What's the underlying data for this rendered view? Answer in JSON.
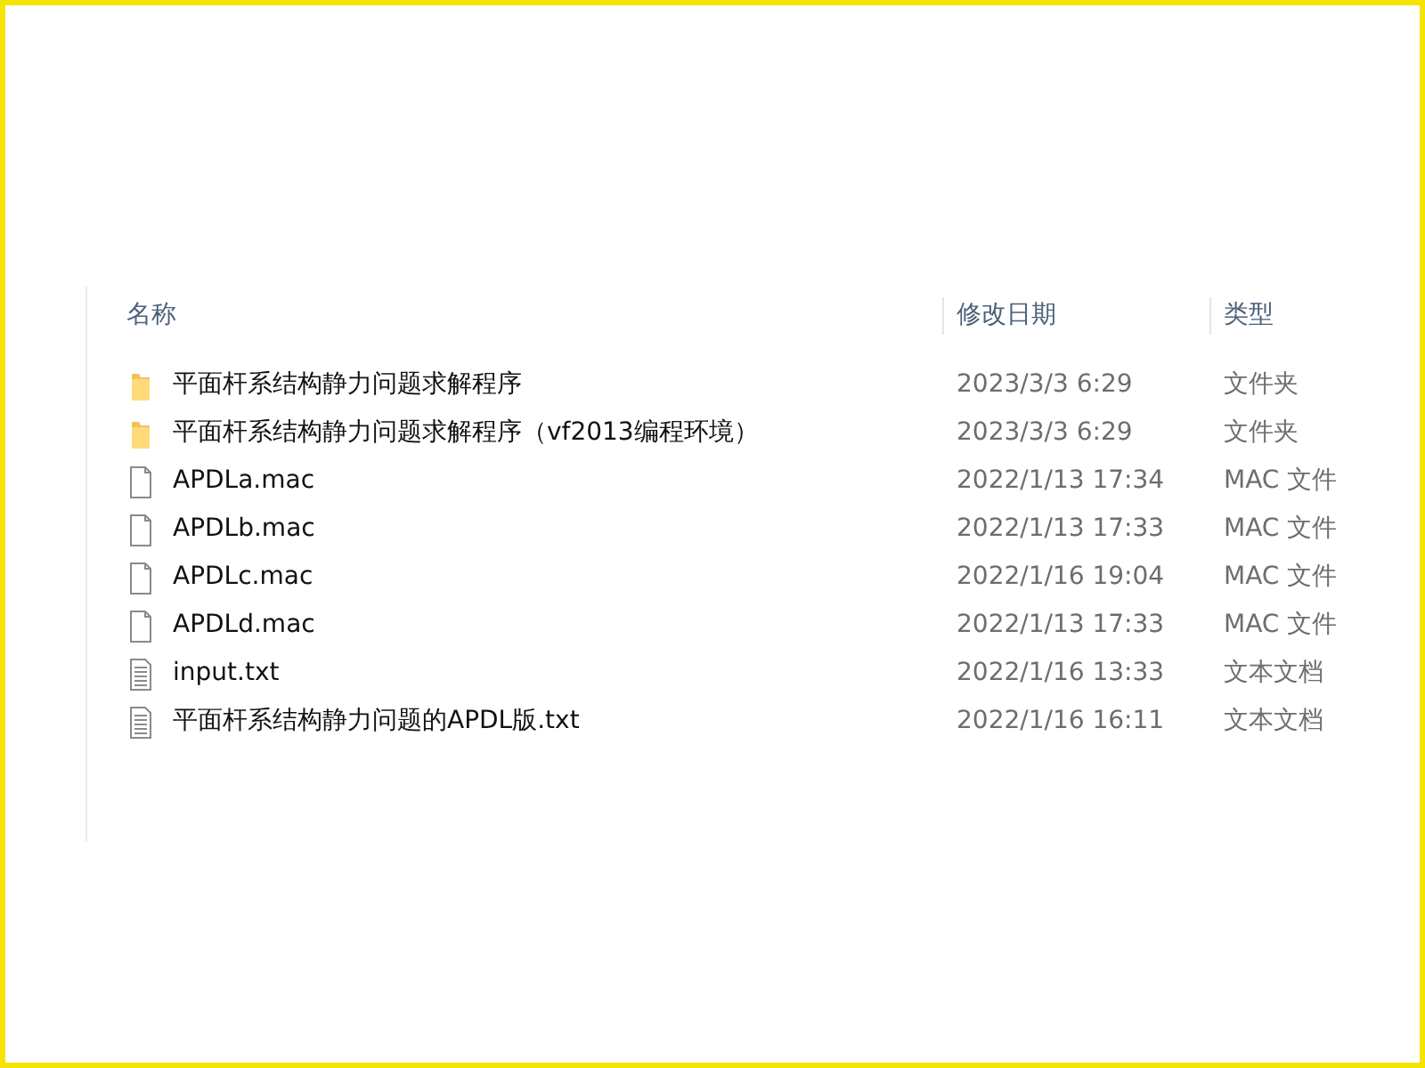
{
  "columns": [
    "名称",
    "修改日期",
    "类型"
  ],
  "files": [
    {
      "kind": "folder",
      "name": "平面杆系结构静力问题求解程序",
      "modified": "2023/3/3 6:29",
      "type": "文件夹"
    },
    {
      "kind": "folder",
      "name": "平面杆系结构静力问题求解程序（vf2013编程环境）",
      "modified": "2023/3/3 6:29",
      "type": "文件夹"
    },
    {
      "kind": "file",
      "name": "APDLa.mac",
      "modified": "2022/1/13 17:34",
      "type": "MAC 文件"
    },
    {
      "kind": "file",
      "name": "APDLb.mac",
      "modified": "2022/1/13 17:33",
      "type": "MAC 文件"
    },
    {
      "kind": "file",
      "name": "APDLc.mac",
      "modified": "2022/1/16 19:04",
      "type": "MAC 文件"
    },
    {
      "kind": "file",
      "name": "APDLd.mac",
      "modified": "2022/1/13 17:33",
      "type": "MAC 文件"
    },
    {
      "kind": "text",
      "name": "input.txt",
      "modified": "2022/1/16 13:33",
      "type": "文本文档"
    },
    {
      "kind": "text",
      "name": "平面杆系结构静力问题的APDL版.txt",
      "modified": "2022/1/16 16:11",
      "type": "文本文档"
    }
  ]
}
